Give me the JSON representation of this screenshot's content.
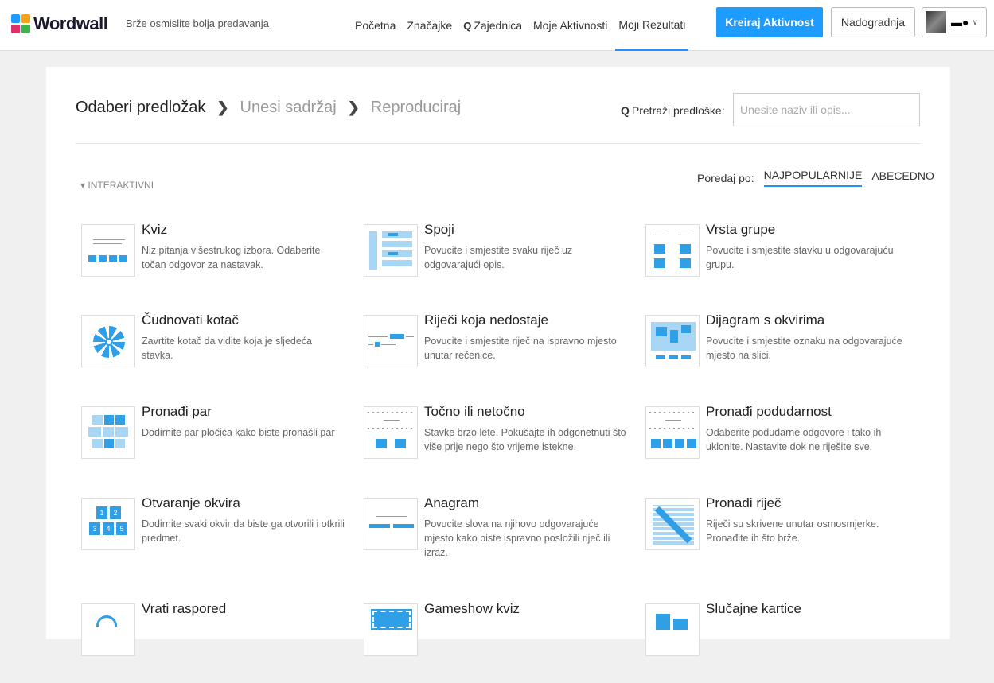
{
  "header": {
    "logo_text": "Wordwall",
    "tagline": "Brže osmislite bolja predavanja",
    "nav": [
      {
        "label": "Početna"
      },
      {
        "label": "Značajke"
      },
      {
        "label": "Zajednica"
      },
      {
        "label": "Moje Aktivnosti"
      },
      {
        "label": "Moji Rezultati"
      }
    ],
    "create_button": "Kreiraj Aktivnost",
    "upgrade_button": "Nadogradnja",
    "colors": {
      "accent": "#1e9bff",
      "logo": [
        "#1e9bff",
        "#f7a31a",
        "#e0306c",
        "#3ab54a"
      ]
    }
  },
  "steps": [
    "Odaberi predložak",
    "Unesi sadržaj",
    "Reproduciraj"
  ],
  "search": {
    "label": "Pretraži predloške:",
    "placeholder": "Unesite naziv ili opis..."
  },
  "section": {
    "label": "INTERAKTIVNI"
  },
  "sort": {
    "label": "Poredaj po:",
    "options": [
      "NAJPOPULARNIJE",
      "ABECEDNO"
    ],
    "selected": "NAJPOPULARNIJE"
  },
  "templates": [
    {
      "title": "Kviz",
      "desc": "Niz pitanja višestrukog izbora. Odaberite točan odgovor za nastavak.",
      "icon": "quiz-icon"
    },
    {
      "title": "Spoji",
      "desc": "Povucite i smjestite svaku riječ uz odgovarajući opis.",
      "icon": "match-up-icon"
    },
    {
      "title": "Vrsta grupe",
      "desc": "Povucite i smjestite stavku u odgovarajuću grupu.",
      "icon": "group-sort-icon"
    },
    {
      "title": "Čudnovati kotač",
      "desc": "Zavrtite kotač da vidite koja je sljedeća stavka.",
      "icon": "wheel-icon"
    },
    {
      "title": "Riječi koja nedostaje",
      "desc": "Povucite i smjestite riječ na ispravno mjesto unutar rečenice.",
      "icon": "missing-word-icon"
    },
    {
      "title": "Dijagram s okvirima",
      "desc": "Povucite i smjestite oznaku na odgovarajuće mjesto na slici.",
      "icon": "labelled-diagram-icon"
    },
    {
      "title": "Pronađi par",
      "desc": "Dodirnite par pločica kako biste pronašli par",
      "icon": "matching-pairs-icon"
    },
    {
      "title": "Točno ili netočno",
      "desc": "Stavke brzo lete. Pokušajte ih odgonetnuti što više prije nego što vrijeme istekne.",
      "icon": "true-false-icon"
    },
    {
      "title": "Pronađi podudarnost",
      "desc": "Odaberite podudarne odgovore i tako ih uklonite. Nastavite dok ne riješite sve.",
      "icon": "find-match-icon"
    },
    {
      "title": "Otvaranje okvira",
      "desc": "Dodirnite svaki okvir da biste ga otvorili i otkrili predmet.",
      "icon": "open-box-icon"
    },
    {
      "title": "Anagram",
      "desc": "Povucite slova na njihovo odgovarajuće mjesto kako biste ispravno posložili riječ ili izraz.",
      "icon": "anagram-icon"
    },
    {
      "title": "Pronađi riječ",
      "desc": "Riječi su skrivene unutar osmosmjerke. Pronađite ih što brže.",
      "icon": "wordsearch-icon"
    },
    {
      "title": "Vrati raspored",
      "desc": "",
      "icon": "unjumble-icon"
    },
    {
      "title": "Gameshow kviz",
      "desc": "",
      "icon": "gameshow-icon"
    },
    {
      "title": "Slučajne kartice",
      "desc": "",
      "icon": "random-cards-icon"
    }
  ]
}
